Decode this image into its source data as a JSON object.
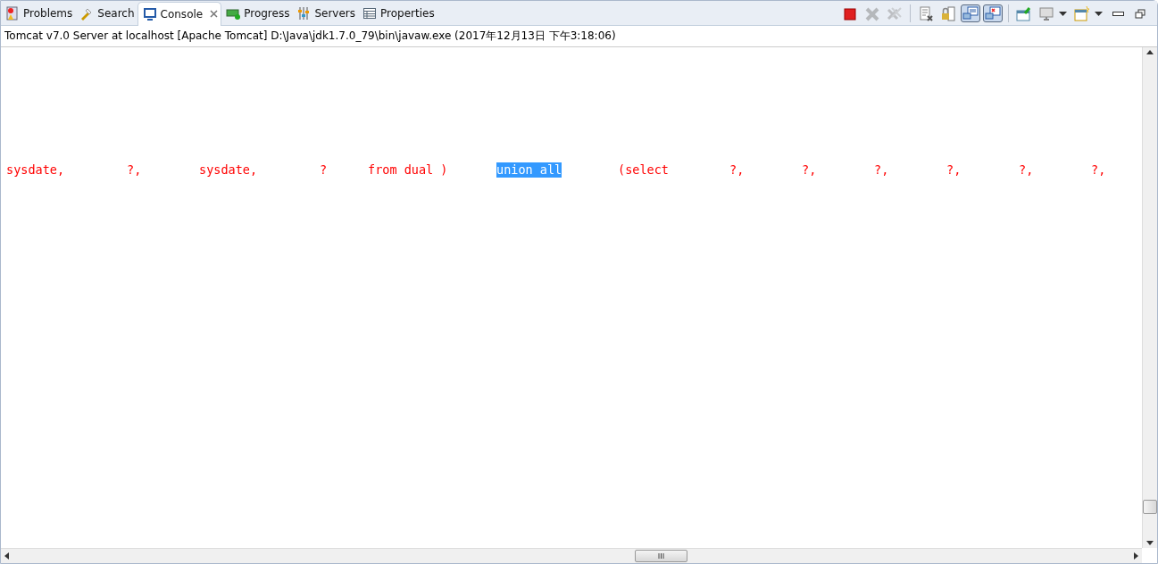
{
  "tabs": [
    {
      "label": "Problems",
      "selected": false
    },
    {
      "label": "Search",
      "selected": false
    },
    {
      "label": "Console",
      "selected": true
    },
    {
      "label": "Progress",
      "selected": false
    },
    {
      "label": "Servers",
      "selected": false
    },
    {
      "label": "Properties",
      "selected": false
    }
  ],
  "toolbar": [
    {
      "kind": "terminate",
      "disabled": false,
      "pressed": false
    },
    {
      "kind": "remove",
      "disabled": true,
      "pressed": false
    },
    {
      "kind": "remove-all",
      "disabled": true,
      "pressed": false
    },
    {
      "kind": "sep"
    },
    {
      "kind": "clear",
      "disabled": false,
      "pressed": false
    },
    {
      "kind": "scroll-lock",
      "disabled": false,
      "pressed": false
    },
    {
      "kind": "show-out",
      "disabled": false,
      "pressed": true
    },
    {
      "kind": "show-err",
      "disabled": false,
      "pressed": true
    },
    {
      "kind": "sep"
    },
    {
      "kind": "pin",
      "disabled": false,
      "pressed": false
    },
    {
      "kind": "display",
      "disabled": false,
      "pressed": false
    },
    {
      "kind": "dropdown"
    },
    {
      "kind": "new-console",
      "disabled": false,
      "pressed": false
    },
    {
      "kind": "dropdown"
    },
    {
      "kind": "minimize"
    },
    {
      "kind": "restore"
    }
  ],
  "console": {
    "process": "Tomcat v7.0 Server at localhost [Apache Tomcat] D:\\Java\\jdk1.7.0_79\\bin\\javaw.exe (2017年12月13日 下午3:18:06)",
    "tokens": [
      {
        "text": "sysdate,",
        "selected": false
      },
      {
        "text": "?,",
        "selected": false
      },
      {
        "text": "sysdate,",
        "selected": false
      },
      {
        "text": "?",
        "selected": false
      },
      {
        "text": "from dual )",
        "selected": false
      },
      {
        "text": "union all",
        "selected": true
      },
      {
        "text": "(select",
        "selected": false
      },
      {
        "text": "?,",
        "selected": false
      },
      {
        "text": "?,",
        "selected": false
      },
      {
        "text": "?,",
        "selected": false
      },
      {
        "text": "?,",
        "selected": false
      },
      {
        "text": "?,",
        "selected": false
      },
      {
        "text": "?,",
        "selected": false
      }
    ]
  }
}
